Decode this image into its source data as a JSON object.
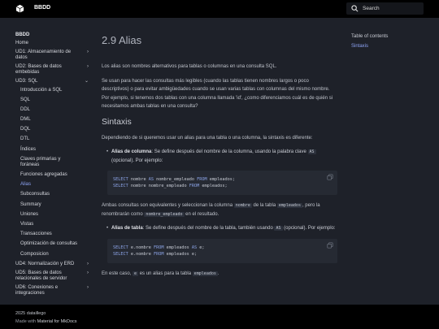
{
  "header": {
    "site_title": "BBDD",
    "search_placeholder": "Search"
  },
  "sidebar": {
    "title": "BBDD",
    "items": [
      {
        "label": "Home"
      },
      {
        "label": "UD1: Almacenamiento de datos",
        "has_children": true
      },
      {
        "label": "UD2: Bases de datos embebidas",
        "has_children": true
      },
      {
        "label": "UD3: SQL",
        "expanded": true
      }
    ],
    "subitems": [
      "Introducción a SQL",
      "SQL",
      "DDL",
      "DML",
      "DQL",
      "DTL",
      "Índices",
      "Claves primarias y foráneas",
      "Funciones agregadas",
      "Alias",
      "Subconsultas",
      "Summary",
      "Uniones",
      "Vistas",
      "Transacciones",
      "Optimización de consultas",
      "Composicion"
    ],
    "active_subitem": "Alias",
    "after_items": [
      {
        "label": "UD4: Normalización y ERD"
      },
      {
        "label": "UD5: Bases de datos relacionales de servidor"
      },
      {
        "label": "UD6: Conexiones e integraciones"
      }
    ]
  },
  "content": {
    "title": "2.9 Alias",
    "p1": "Los alias son nombres alternativos para tablas o columnas en una consulta SQL.",
    "p2": "Se usan para hacer las consultas más legibles (cuando las tablas tienen nombres largos o poco descriptivos) o para evitar ambigüedades cuando se usan varias tablas con columnas del mismo nombre. Por ejemplo, si tenemos dos tablas con una columna llamada 'id', ¿como diferenciamos cuál es de quién si necesitamos ambas tablas en una consulta?",
    "h2": "Sintaxis",
    "p3": "Dependiendo de si queremos usar un alias para una tabla o una columna, la sintaxis es diferente:",
    "bullet1_bold": "Alias de columna",
    "bullet1_a": ": Se define después del nombre de la columna, usando la palabra clave ",
    "bullet1_code": "AS",
    "bullet1_b": " (opcional). Por ejemplo:",
    "code1": [
      {
        "kw1": "SELECT",
        "t1": " nombre ",
        "kw2": "AS",
        "t2": " nombre_empleado ",
        "kw3": "FROM",
        "t3": " empleados;"
      },
      {
        "kw1": "SELECT",
        "t1": " nombre nombre_empleado ",
        "kw2": "",
        "t2": "",
        "kw3": "FROM",
        "t3": " empleados;"
      }
    ],
    "p4_a": "Ambas consultas son equivalentes y seleccionan la columna ",
    "p4_code1": "nombre",
    "p4_b": " de la tabla ",
    "p4_code2": "empleados",
    "p4_c": ", pero la renombrarán como ",
    "p4_code3": "nombre_empleado",
    "p4_d": " en el resultado.",
    "bullet2_bold": "Alias de tabla",
    "bullet2_a": ": Se define después del nombre de la tabla, también usando ",
    "bullet2_code": "AS",
    "bullet2_b": " (opcional). Por ejemplo:",
    "code2": [
      {
        "kw1": "SELECT",
        "t1": " e.nombre ",
        "kw2": "FROM",
        "t2": " empleados ",
        "kw3": "AS",
        "t3": " e;"
      },
      {
        "kw1": "SELECT",
        "t1": " e.nombre ",
        "kw2": "FROM",
        "t2": " empleados e;",
        "kw3": "",
        "t3": ""
      }
    ],
    "p5_a": "En este caso, ",
    "p5_code1": "e",
    "p5_b": " es un alias para la tabla ",
    "p5_code2": "empleados",
    "p5_c": "."
  },
  "toc": {
    "title": "Table of contents",
    "items": [
      "Sintaxis"
    ]
  },
  "footer": {
    "copyright": "2025 dataillego",
    "made_with_a": "Made with ",
    "made_with_link": "Material for MkDocs"
  },
  "colors": {
    "accent": "#8ea4f5",
    "background": "#1e2129",
    "header": "#000000"
  }
}
